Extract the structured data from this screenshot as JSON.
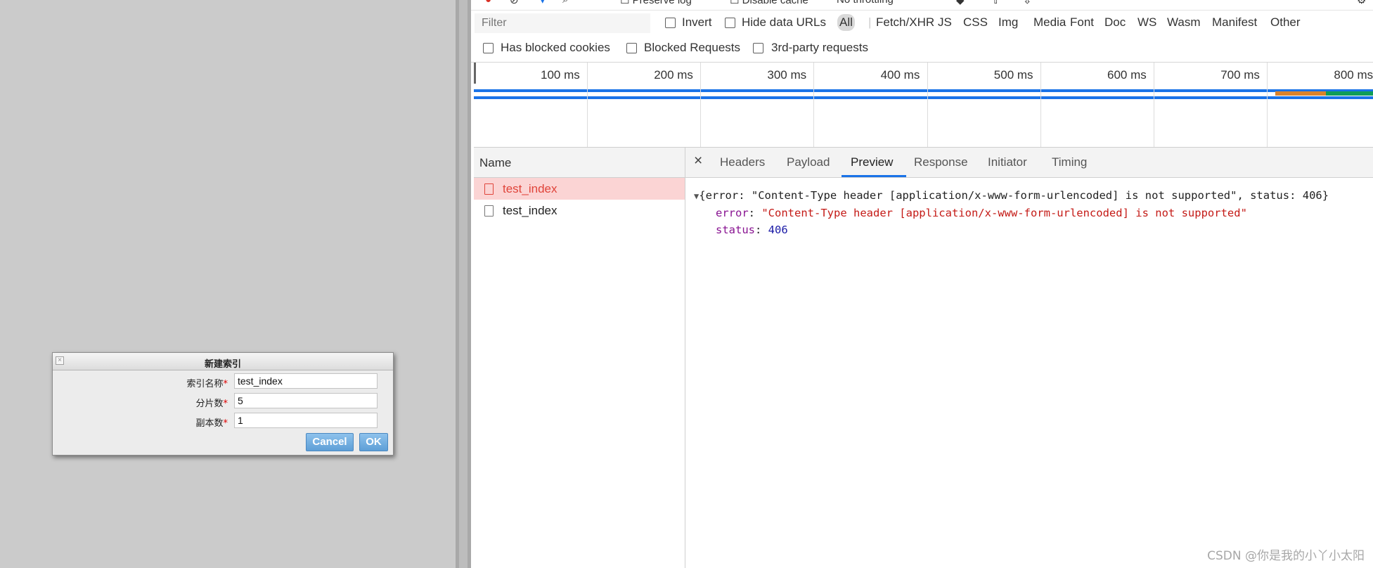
{
  "dialog": {
    "title": "新建索引",
    "close_glyph": "×",
    "required_mark": "*",
    "fields": [
      {
        "label": "索引名称",
        "value": "test_index"
      },
      {
        "label": "分片数",
        "value": "5"
      },
      {
        "label": "副本数",
        "value": "1"
      }
    ],
    "cancel_label": "Cancel",
    "ok_label": "OK"
  },
  "devtools": {
    "top_fragments": [
      "Preserve log",
      "Disable cache",
      "No throttling"
    ],
    "filter": {
      "placeholder": "Filter",
      "invert_label": "Invert",
      "hide_data_urls_label": "Hide data URLs",
      "types": [
        "All",
        "Fetch/XHR",
        "JS",
        "CSS",
        "Img",
        "Media",
        "Font",
        "Doc",
        "WS",
        "Wasm",
        "Manifest",
        "Other"
      ],
      "active_type": "All"
    },
    "cookie_filters": {
      "has_blocked_cookies": "Has blocked cookies",
      "blocked_requests": "Blocked Requests",
      "third_party": "3rd-party requests"
    },
    "timeline": {
      "ticks": [
        "100 ms",
        "200 ms",
        "300 ms",
        "400 ms",
        "500 ms",
        "600 ms",
        "700 ms",
        "800 ms"
      ],
      "colors": {
        "primary": "#1a73e8",
        "waiting": "#d9822b",
        "download": "#0f9d58"
      }
    },
    "name_column_header": "Name",
    "requests": [
      {
        "name": "test_index",
        "selected": true
      },
      {
        "name": "test_index",
        "selected": false
      }
    ],
    "detail_tabs": [
      "Headers",
      "Payload",
      "Preview",
      "Response",
      "Initiator",
      "Timing"
    ],
    "active_tab": "Preview",
    "preview": {
      "summary": "{error: \"Content-Type header [application/x-www-form-urlencoded] is not supported\", status: 406}",
      "error_key": "error",
      "error_value": "\"Content-Type header [application/x-www-form-urlencoded] is not supported\"",
      "status_key": "status",
      "status_value": "406"
    }
  },
  "watermark": "CSDN @你是我的小丫小太阳"
}
